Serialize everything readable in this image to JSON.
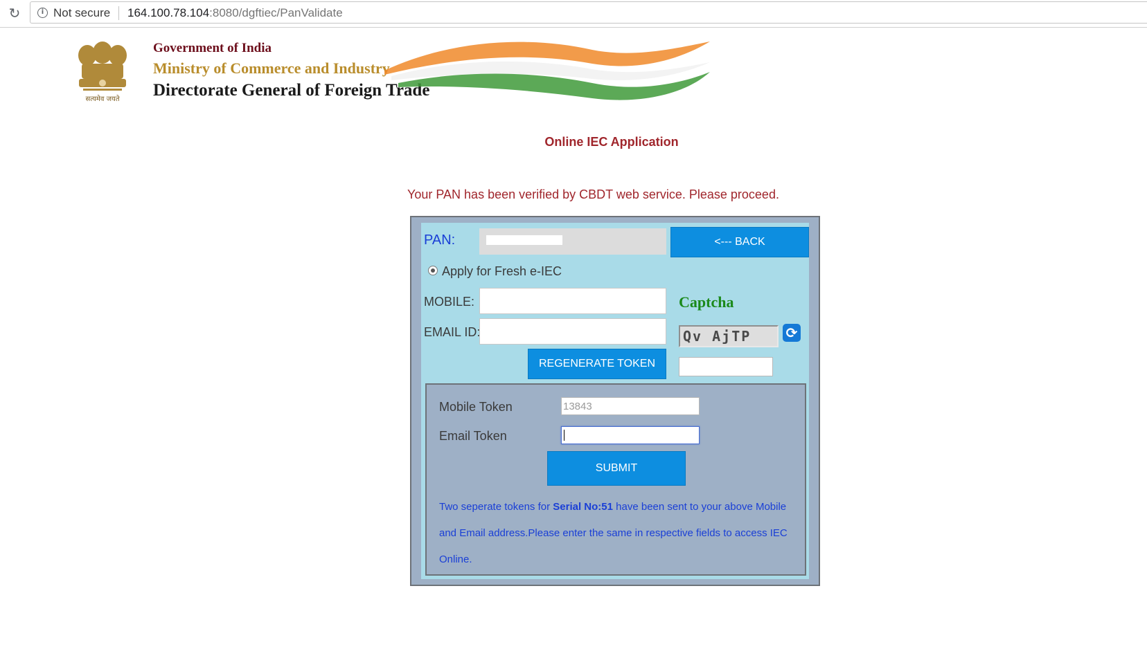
{
  "browser": {
    "security_label": "Not secure",
    "url_host": "164.100.78.104",
    "url_path": ":8080/dgftiec/PanValidate"
  },
  "header": {
    "line1": "Government of India",
    "line2": "Ministry of Commerce and Industry",
    "line3": "Directorate General of Foreign Trade",
    "emblem_caption": "सत्यमेव जयते"
  },
  "page": {
    "title": "Online IEC Application",
    "pan_message": "Your PAN has been verified by CBDT web service. Please proceed."
  },
  "form": {
    "pan_label": "PAN:",
    "back_button": "<--- BACK",
    "radio_label": "Apply for Fresh e-IEC",
    "mobile_label": "MOBILE:",
    "email_label": "EMAIL ID:",
    "regenerate_button": "REGENERATE TOKEN",
    "captcha_title": "Captcha",
    "captcha_text": "Qv AjTP",
    "mobile_token_label": "Mobile Token",
    "mobile_token_value": "13843",
    "email_token_label": "Email Token",
    "submit_button": "SUBMIT",
    "info_prefix": " Two seperate tokens for ",
    "info_serial": "Serial No:51",
    "info_suffix": " have been sent to your above Mobile and Email address.Please enter the same in respective fields to access IEC Online."
  },
  "colors": {
    "button_blue": "#0d8ee0",
    "title_red": "#a0262c",
    "panel_bg": "#a9dbe8",
    "captcha_green": "#1b8a1b"
  }
}
